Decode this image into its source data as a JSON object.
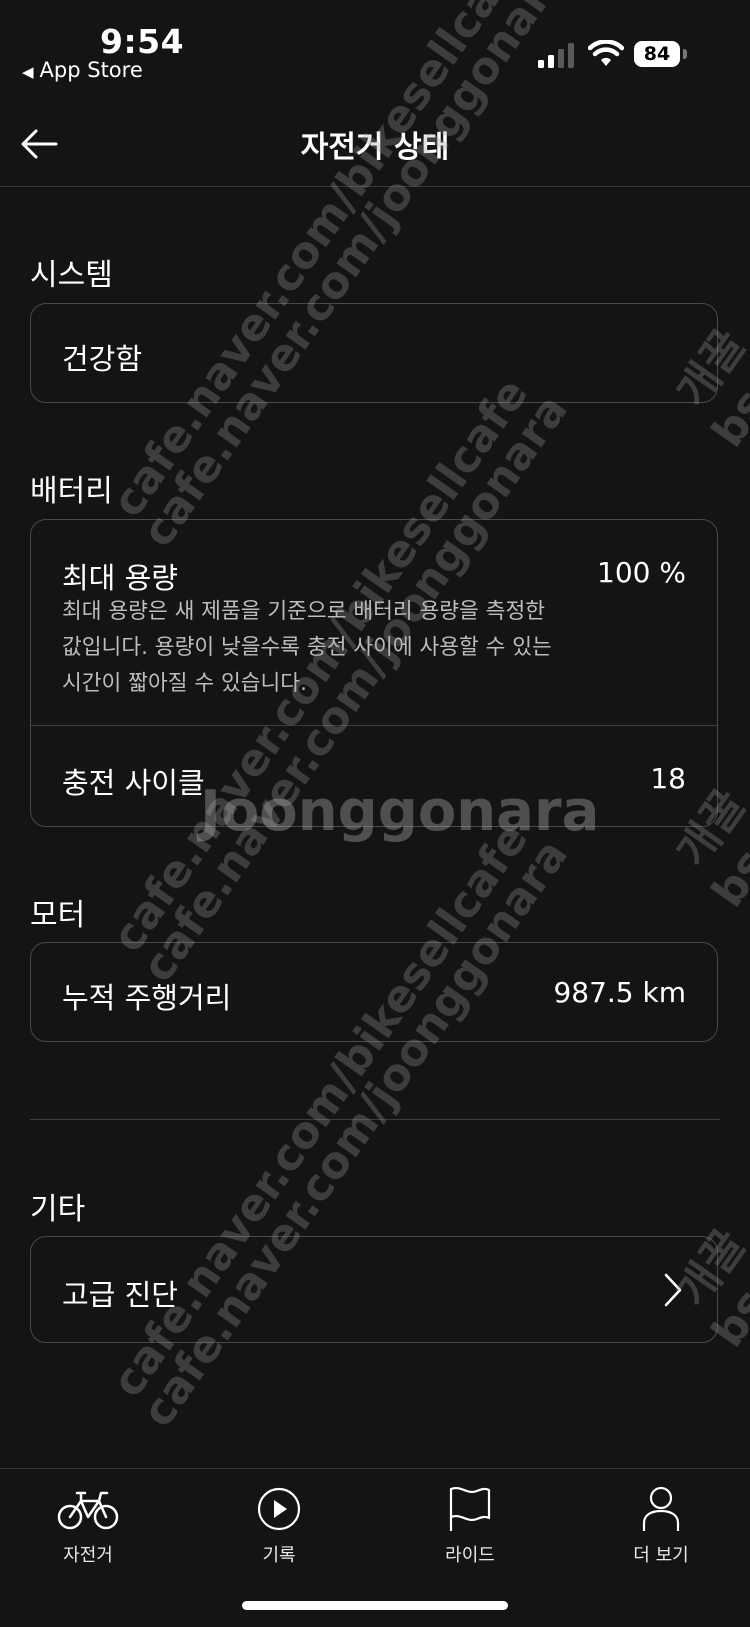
{
  "status_bar": {
    "time": "9:54",
    "back_app": "App Store",
    "battery": "84"
  },
  "header": {
    "title": "자전거 상태"
  },
  "sections": {
    "system": {
      "title": "시스템",
      "status": "건강함"
    },
    "battery": {
      "title": "배터리",
      "max_capacity_label": "최대 용량",
      "max_capacity_value": "100 %",
      "description_lines": [
        "최대 용량은 새 제품을 기준으로 배터리 용량을 측정한",
        "값입니다. 용량이 낮을수록 충전 사이에 사용할 수 있는",
        "시간이 짧아질 수 있습니다."
      ],
      "charge_cycles_label": "충전 사이클",
      "charge_cycles_value": "18"
    },
    "motor": {
      "title": "모터",
      "odometer_label": "누적 주행거리",
      "odometer_value": "987.5 km"
    },
    "other": {
      "title": "기타",
      "diagnostics_label": "고급 진단"
    }
  },
  "watermarks": {
    "cafe_bikesellcafe": "cafe.naver.com/bikesellcafe",
    "cafe_joonggonara": "cafe.naver.com/joonggonara",
    "brand": "Joonggonara",
    "side_text": "개꿀",
    "side_text2": "bs"
  },
  "tabbar": {
    "tabs": [
      {
        "label": "자전거",
        "icon": "bicycle-icon",
        "active": true
      },
      {
        "label": "기록",
        "icon": "play-circle-icon",
        "active": false
      },
      {
        "label": "라이드",
        "icon": "flag-icon",
        "active": false
      },
      {
        "label": "더 보기",
        "icon": "person-icon",
        "active": false
      }
    ]
  },
  "colors": {
    "background": "#141414",
    "card_border": "#4a4a4a",
    "text": "#ffffff",
    "muted_text": "#bdbdbd"
  }
}
